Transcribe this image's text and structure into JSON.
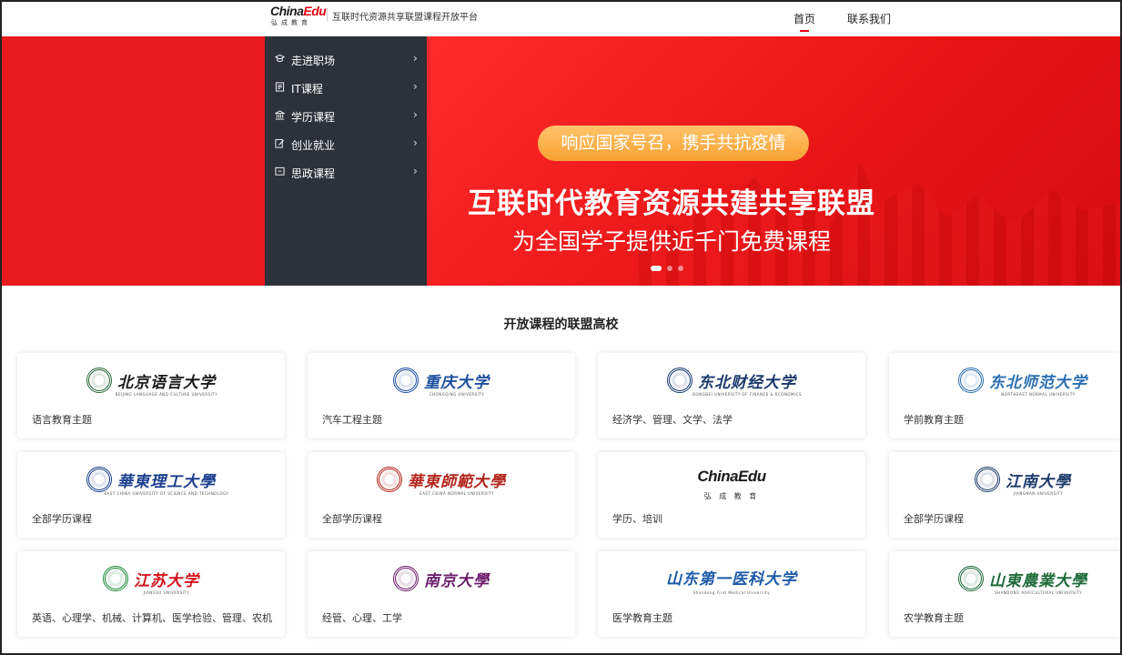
{
  "header": {
    "logo_main_1": "China",
    "logo_main_2": "Edu",
    "logo_sub": "弘成教育",
    "slogan": "互联时代资源共享联盟课程开放平台",
    "nav": [
      {
        "label": "首页",
        "active": true
      },
      {
        "label": "联系我们",
        "active": false
      }
    ]
  },
  "menu": {
    "items": [
      {
        "label": "走进职场",
        "icon": "graduation-cap-icon"
      },
      {
        "label": "IT课程",
        "icon": "document-icon"
      },
      {
        "label": "学历课程",
        "icon": "building-icon"
      },
      {
        "label": "创业就业",
        "icon": "edit-icon"
      },
      {
        "label": "思政课程",
        "icon": "screen-icon"
      }
    ],
    "chevron": "›"
  },
  "hero": {
    "pill": "响应国家号召，携手共抗疫情",
    "title": "互联时代教育资源共建共享联盟",
    "subtitle": "为全国学子提供近千门免费课程",
    "slides": 3,
    "active_slide": 1,
    "bg_color": "#e8191c"
  },
  "section": {
    "title": "开放课程的联盟高校"
  },
  "cards": [
    {
      "name": "北京语言大学",
      "en": "BEIJING LANGUAGE AND CULTURE UNIVERSITY",
      "desc": "语言教育主题",
      "color": "#1a1a1a",
      "seal": "#2b6a3a"
    },
    {
      "name": "重庆大学",
      "en": "CHONGQING UNIVERSITY",
      "desc": "汽车工程主题",
      "color": "#1d4e9e",
      "seal": "#1d4e9e"
    },
    {
      "name": "东北财经大学",
      "en": "DONGBEI UNIVERSITY OF FINANCE & ECONOMICS",
      "desc": "经济学、管理、文学、法学",
      "color": "#1a3a6e",
      "seal": "#1a3a6e"
    },
    {
      "name": "东北师范大学",
      "en": "NORTHEAST NORMAL UNIVERSITY",
      "desc": "学前教育主题",
      "color": "#2a6fb0",
      "seal": "#2a6fb0"
    },
    {
      "name": "華東理工大學",
      "en": "EAST CHINA UNIVERSITY OF SCIENCE AND TECHNOLOGY",
      "desc": "全部学历课程",
      "color": "#1b3f8f",
      "seal": "#1b3f8f"
    },
    {
      "name": "華東師範大學",
      "en": "EAST CHINA NORMAL UNIVERSITY",
      "desc": "全部学历课程",
      "color": "#b3261e",
      "seal": "#b3261e"
    },
    {
      "name": "ChinaEdu",
      "en": "弘 成 教 育",
      "desc": "学历、培训",
      "color": "#1a1a1a",
      "seal": ""
    },
    {
      "name": "江南大學",
      "en": "JIANGNAN UNIVERSITY",
      "desc": "全部学历课程",
      "color": "#1f3c6b",
      "seal": "#1f3c6b"
    },
    {
      "name": "江苏大学",
      "en": "JIANGSU UNIVERSITY",
      "desc": "英语、心理学、机械、计算机、医学检验、管理、农机",
      "color": "#d4141c",
      "seal": "#1e8c3a"
    },
    {
      "name": "南京大學",
      "en": "",
      "desc": "经管、心理、工学",
      "color": "#6b1e6b",
      "seal": "#6b1e6b"
    },
    {
      "name": "山东第一医科大学",
      "en": "Shandong First Medical University",
      "desc": "医学教育主题",
      "color": "#1d5aa8",
      "seal": ""
    },
    {
      "name": "山東農業大學",
      "en": "SHANDONG AGRICULTURAL UNIVERSITY",
      "desc": "农学教育主题",
      "color": "#1e6b3a",
      "seal": "#1e6b3a"
    }
  ]
}
